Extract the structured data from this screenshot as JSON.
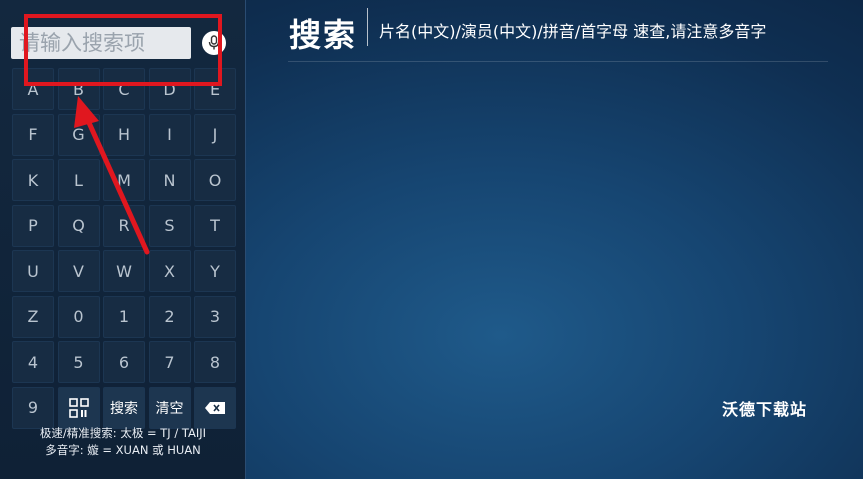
{
  "search": {
    "placeholder": "请输入搜索项",
    "value": ""
  },
  "header": {
    "title": "搜索",
    "hint": "片名(中文)/演员(中文)/拼音/首字母 速查,请注意多音字"
  },
  "keyboard": {
    "keys": [
      "A",
      "B",
      "C",
      "D",
      "E",
      "F",
      "G",
      "H",
      "I",
      "J",
      "K",
      "L",
      "M",
      "N",
      "O",
      "P",
      "Q",
      "R",
      "S",
      "T",
      "U",
      "V",
      "W",
      "X",
      "Y",
      "Z",
      "0",
      "1",
      "2",
      "3",
      "4",
      "5",
      "6",
      "7",
      "8",
      "9"
    ],
    "search_label": "搜索",
    "clear_label": "清空"
  },
  "help": {
    "line1": "极速/精准搜索: 太极 = TJ / TAIJI",
    "line2": "多音字: 嫙 = XUAN 或 HUAN"
  },
  "watermark": "沃德下载站",
  "colors": {
    "annotation": "#e0171f",
    "background": "#164571",
    "panel": "#13283f"
  },
  "icons": [
    "microphone-icon",
    "qr-code-icon",
    "backspace-icon"
  ]
}
